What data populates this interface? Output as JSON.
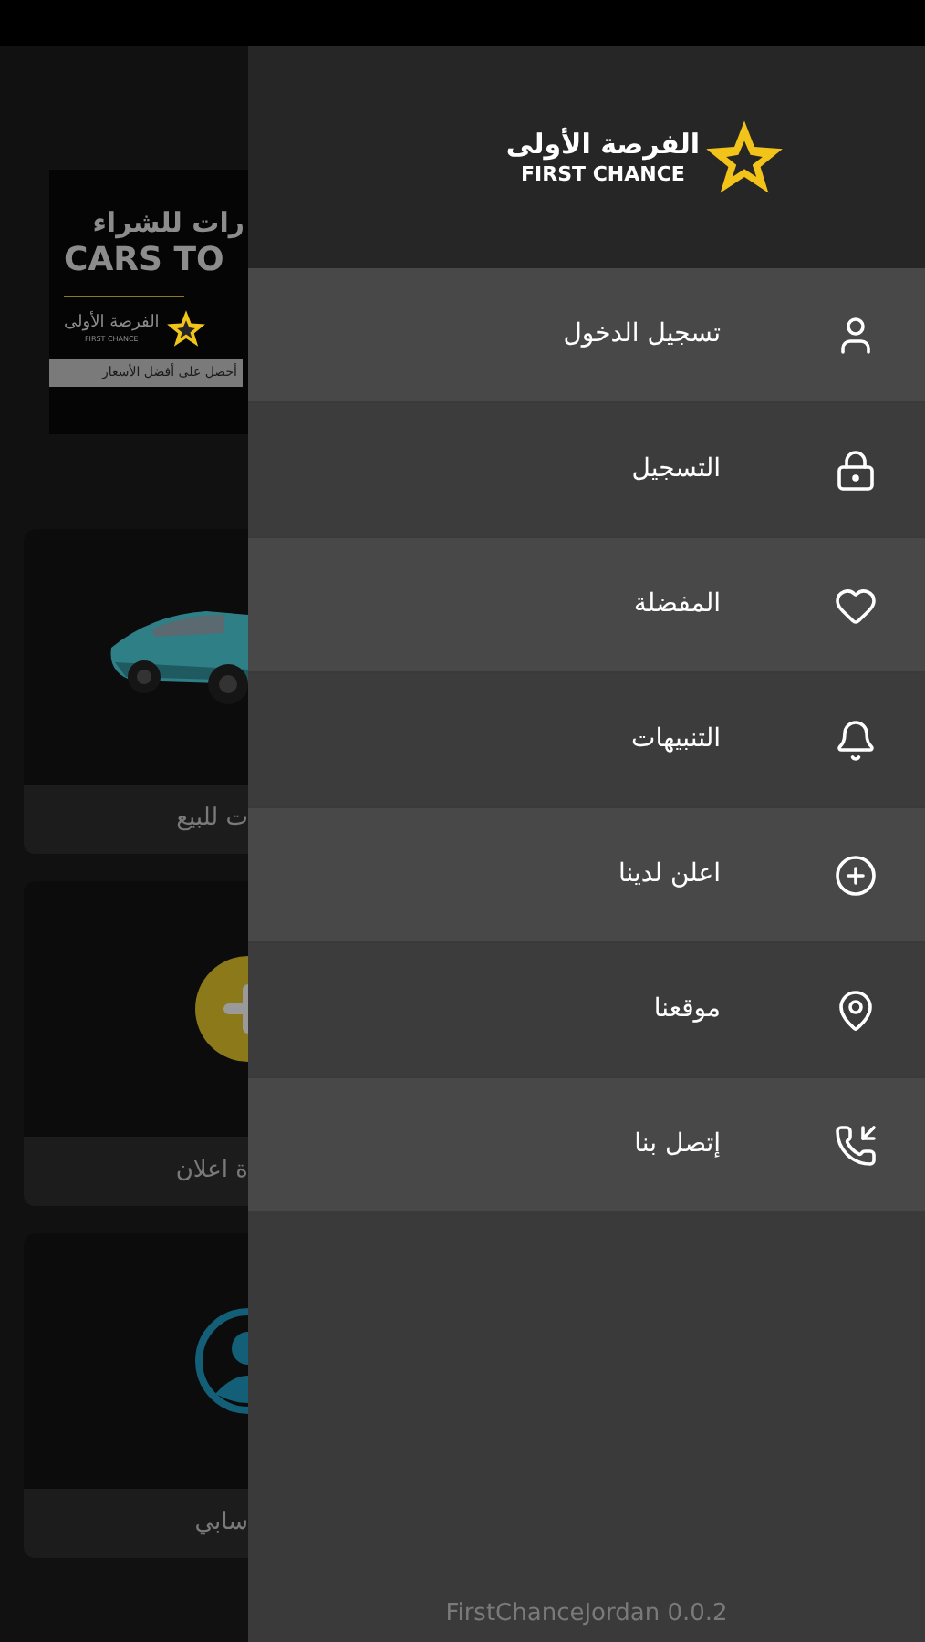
{
  "background": {
    "banner": {
      "title_ar": "رات للشراء",
      "title_en": "CARS TO",
      "logo_ar": "الفرصة الأولى",
      "logo_en": "FIRST CHANCE",
      "tagline": "أحصل على أفضل الأسعار"
    },
    "cards": [
      {
        "kind": "car",
        "label": "ت للبيع"
      },
      {
        "kind": "add",
        "label": "ة اعلان"
      },
      {
        "kind": "account",
        "label": "سابي"
      }
    ]
  },
  "drawer": {
    "logo": {
      "text_ar": "الفرصة الأولى",
      "text_en": "FIRST CHANCE"
    },
    "items": [
      {
        "kind": "login",
        "label": "تسجيل الدخول"
      },
      {
        "kind": "register",
        "label": "التسجيل"
      },
      {
        "kind": "favorites",
        "label": "المفضلة"
      },
      {
        "kind": "alerts",
        "label": "التنبيهات"
      },
      {
        "kind": "advertise",
        "label": "اعلن لدينا"
      },
      {
        "kind": "location",
        "label": "موقعنا"
      },
      {
        "kind": "contact",
        "label": "إتصل بنا"
      }
    ],
    "version": "FirstChanceJordan 0.0.2"
  }
}
